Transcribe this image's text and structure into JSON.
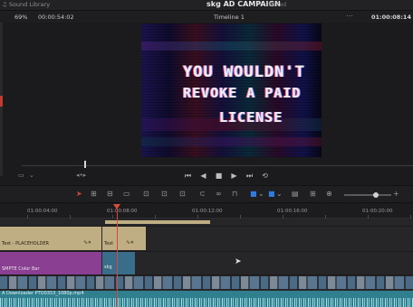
{
  "topbar": {
    "library": "Sound Library",
    "project_title": "skg AD CAMPAIGN",
    "status": "Edited"
  },
  "viewer": {
    "zoom": "69%",
    "source_timecode": "00:00:54:02",
    "timeline_name": "Timeline 1",
    "record_timecode": "01:00:08:14",
    "frame_text_line1": "YOU WOULDN'T",
    "frame_text_line2": "REVOKE A PAID",
    "frame_text_line3": "LICENSE"
  },
  "ruler": {
    "labels": [
      "01:00:04:00",
      "01:00:08:00",
      "01:00:12:00",
      "01:00:16:00",
      "01:00:20:00"
    ]
  },
  "tracks": {
    "v2_clip_label": "Text - PLACEHOLDER",
    "v2_clip2_label": "Text",
    "v1_clip_label": "SMPTE Color Bar",
    "v1_clip2_label": "skg",
    "a1_clip_label": "A Downloader PTO0353_1080p.mp4"
  },
  "colors": {
    "accent_red": "#d64a3c",
    "text_clip": "#bfae84",
    "generator_clip": "#8b3f93",
    "audio_clip": "#2f7f8f"
  }
}
